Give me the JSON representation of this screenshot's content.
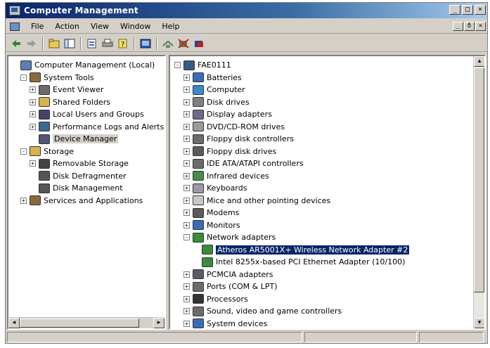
{
  "window": {
    "title": "Computer Management"
  },
  "title_buttons": {
    "minimize": "_",
    "maximize": "□",
    "close": "×"
  },
  "menu": [
    "File",
    "Action",
    "View",
    "Window",
    "Help"
  ],
  "mdi_buttons": {
    "minimize": "_",
    "restore": "ð",
    "close": "×"
  },
  "toolbar": {
    "icons": [
      "back-arrow-icon",
      "forward-arrow-icon",
      "up-folder-icon",
      "show-tree-icon",
      "properties-icon",
      "print-icon",
      "help-icon",
      "console-icon",
      "scan-hardware-icon",
      "disable-device-icon",
      "uninstall-device-icon"
    ]
  },
  "left_tree": [
    {
      "label": "Computer Management (Local)",
      "level": 0,
      "expander": "",
      "icon": "computer-management-icon",
      "color": "#5a7fb8"
    },
    {
      "label": "System Tools",
      "level": 1,
      "expander": "-",
      "icon": "system-tools-icon",
      "color": "#8c6b3a"
    },
    {
      "label": "Event Viewer",
      "level": 2,
      "expander": "+",
      "icon": "event-viewer-icon",
      "color": "#6b6b6b"
    },
    {
      "label": "Shared Folders",
      "level": 2,
      "expander": "+",
      "icon": "shared-folders-icon",
      "color": "#d8b24a"
    },
    {
      "label": "Local Users and Groups",
      "level": 2,
      "expander": "+",
      "icon": "users-icon",
      "color": "#444466"
    },
    {
      "label": "Performance Logs and Alerts",
      "level": 2,
      "expander": "+",
      "icon": "performance-icon",
      "color": "#3a6b8c"
    },
    {
      "label": "Device Manager",
      "level": 2,
      "expander": "",
      "icon": "device-manager-icon",
      "color": "#555577"
    },
    {
      "label": "Storage",
      "level": 1,
      "expander": "-",
      "icon": "storage-icon",
      "color": "#d8b24a"
    },
    {
      "label": "Removable Storage",
      "level": 2,
      "expander": "+",
      "icon": "removable-storage-icon",
      "color": "#444444"
    },
    {
      "label": "Disk Defragmenter",
      "level": 2,
      "expander": "",
      "icon": "defragmenter-icon",
      "color": "#555555"
    },
    {
      "label": "Disk Management",
      "level": 2,
      "expander": "",
      "icon": "disk-management-icon",
      "color": "#555555"
    },
    {
      "label": "Services and Applications",
      "level": 1,
      "expander": "+",
      "icon": "services-icon",
      "color": "#8c6b3a"
    }
  ],
  "right_tree": [
    {
      "label": "FAE0111",
      "level": 0,
      "expander": "-",
      "icon": "computer-icon",
      "color": "#3a5a8c"
    },
    {
      "label": "Batteries",
      "level": 1,
      "expander": "+",
      "icon": "battery-icon",
      "color": "#3a6bb8"
    },
    {
      "label": "Computer",
      "level": 1,
      "expander": "+",
      "icon": "computer-icon",
      "color": "#3a8cc8"
    },
    {
      "label": "Disk drives",
      "level": 1,
      "expander": "+",
      "icon": "disk-drive-icon",
      "color": "#808080"
    },
    {
      "label": "Display adapters",
      "level": 1,
      "expander": "+",
      "icon": "display-adapter-icon",
      "color": "#6b6b8c"
    },
    {
      "label": "DVD/CD-ROM drives",
      "level": 1,
      "expander": "+",
      "icon": "cdrom-icon",
      "color": "#9a9a9a"
    },
    {
      "label": "Floppy disk controllers",
      "level": 1,
      "expander": "+",
      "icon": "floppy-controller-icon",
      "color": "#6b6b6b"
    },
    {
      "label": "Floppy disk drives",
      "level": 1,
      "expander": "+",
      "icon": "floppy-drive-icon",
      "color": "#5a5a5a"
    },
    {
      "label": "IDE ATA/ATAPI controllers",
      "level": 1,
      "expander": "+",
      "icon": "ide-controller-icon",
      "color": "#6b6b6b"
    },
    {
      "label": "Infrared devices",
      "level": 1,
      "expander": "+",
      "icon": "infrared-icon",
      "color": "#4a8c4a"
    },
    {
      "label": "Keyboards",
      "level": 1,
      "expander": "+",
      "icon": "keyboard-icon",
      "color": "#9a9aaa"
    },
    {
      "label": "Mice and other pointing devices",
      "level": 1,
      "expander": "+",
      "icon": "mouse-icon",
      "color": "#c8c8c8"
    },
    {
      "label": "Modems",
      "level": 1,
      "expander": "+",
      "icon": "modem-icon",
      "color": "#5a5a5a"
    },
    {
      "label": "Monitors",
      "level": 1,
      "expander": "+",
      "icon": "monitor-icon",
      "color": "#3a6bb8"
    },
    {
      "label": "Network adapters",
      "level": 1,
      "expander": "-",
      "icon": "network-adapter-icon",
      "color": "#3a8c3a"
    },
    {
      "label": "Atheros AR5001X+ Wireless Network Adapter #2",
      "level": 2,
      "expander": "",
      "icon": "network-adapter-icon",
      "color": "#3a8c3a",
      "selected": true
    },
    {
      "label": "Intel 8255x-based PCI Ethernet Adapter (10/100)",
      "level": 2,
      "expander": "",
      "icon": "network-adapter-icon",
      "color": "#3a8c3a"
    },
    {
      "label": "PCMCIA adapters",
      "level": 1,
      "expander": "+",
      "icon": "pcmcia-icon",
      "color": "#5a5a6b"
    },
    {
      "label": "Ports (COM & LPT)",
      "level": 1,
      "expander": "+",
      "icon": "ports-icon",
      "color": "#6b6b6b"
    },
    {
      "label": "Processors",
      "level": 1,
      "expander": "+",
      "icon": "processor-icon",
      "color": "#333333"
    },
    {
      "label": "Sound, video and game controllers",
      "level": 1,
      "expander": "+",
      "icon": "sound-icon",
      "color": "#6b6b6b"
    },
    {
      "label": "System devices",
      "level": 1,
      "expander": "+",
      "icon": "system-devices-icon",
      "color": "#3a6bb8"
    }
  ],
  "scroll_arrows": {
    "left": "◂",
    "right": "▸",
    "up": "▴",
    "down": "▾"
  }
}
